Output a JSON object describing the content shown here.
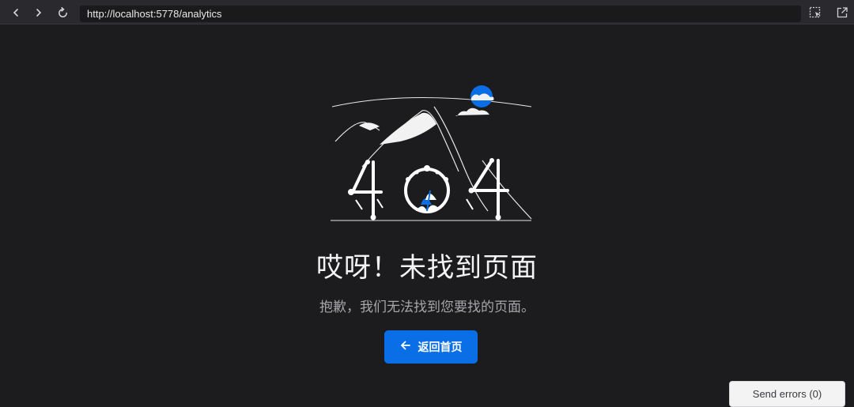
{
  "browser": {
    "url": "http://localhost:5778/analytics",
    "icons": [
      "back-arrow-icon",
      "forward-arrow-icon",
      "reload-icon",
      "element-picker-icon",
      "open-external-icon"
    ]
  },
  "error_page": {
    "illustration_text": "404",
    "title": "哎呀！未找到页面",
    "subtitle": "抱歉，我们无法找到您要找的页面。",
    "home_button_label": "返回首页",
    "accent_color": "#0a6fe6"
  },
  "devtools": {
    "send_errors_label": "Send errors (0)"
  }
}
